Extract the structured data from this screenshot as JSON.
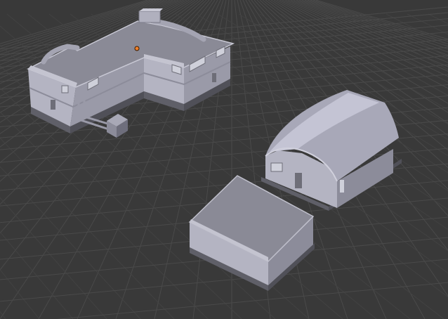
{
  "viewport": {
    "background": "#393939",
    "grid_color": "#4a4a4a",
    "grid_minor_color": "#424242",
    "origin_color": "#f0802a"
  },
  "scene": {
    "objects": [
      {
        "name": "main-building",
        "type": "mesh"
      },
      {
        "name": "quonset-hangar",
        "type": "mesh"
      },
      {
        "name": "storage-block",
        "type": "mesh"
      }
    ],
    "selected_origin_marker": true
  },
  "palette": {
    "roof": "#8a8a96",
    "roof_light": "#9a9aa8",
    "wall_light": "#b4b4c2",
    "wall_mid": "#a0a0ae",
    "wall_dark": "#7e7e8c",
    "base": "#5f5f68",
    "base_dark": "#505058",
    "window": "#cfd0da",
    "door": "#6e6e78"
  }
}
